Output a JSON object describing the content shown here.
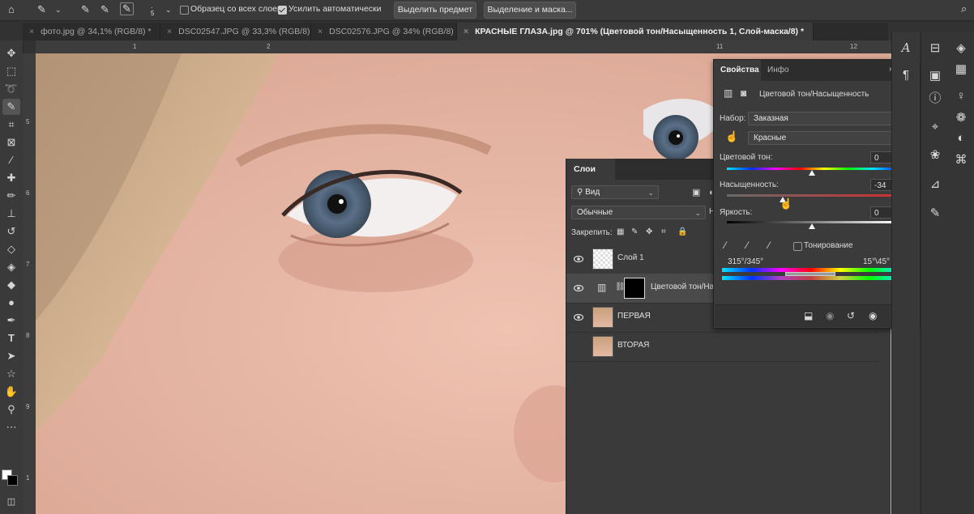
{
  "options_bar": {
    "brush_size": "5",
    "sample_all_layers_label": "Образец со всех слоев",
    "auto_enhance_label": "Усилить автоматически",
    "select_subject_label": "Выделить предмет",
    "select_mask_label": "Выделение и маска..."
  },
  "tabs": [
    {
      "label": "фото.jpg @ 34,1% (RGB/8) *",
      "active": false
    },
    {
      "label": "DSC02547.JPG @ 33,3% (RGB/8)",
      "active": false
    },
    {
      "label": "DSC02576.JPG @ 34% (RGB/8)",
      "active": false
    },
    {
      "label": "КРАСНЫЕ ГЛАЗА.jpg @ 701% (Цветовой тон/Насыщенность 1, Слой-маска/8) *",
      "active": true
    }
  ],
  "ruler_top": {
    "t1": "1",
    "t2": "2",
    "t3": "11",
    "t4": "12"
  },
  "ruler_left": {
    "t1": "5",
    "t2": "6",
    "t3": "7",
    "t4": "8",
    "t5": "9",
    "t6": "1"
  },
  "layers_panel": {
    "tab_label": "Слои",
    "filter_kind": "Вид",
    "blend_mode": "Обычные",
    "opacity_prefix": "Н",
    "lock_label": "Закрепить:",
    "layers": [
      {
        "name": "Слой 1",
        "visible": true
      },
      {
        "name": "Цветовой тон/Нас",
        "visible": true
      },
      {
        "name": "ПЕРВАЯ",
        "visible": true
      },
      {
        "name": "ВТОРАЯ",
        "visible": false
      }
    ]
  },
  "properties_panel": {
    "tab_properties": "Свойства",
    "tab_info": "Инфо",
    "adjustment_title": "Цветовой тон/Насыщенность",
    "preset_label": "Набор:",
    "preset_value": "Заказная",
    "channel_value": "Красные",
    "hue_label": "Цветовой тон:",
    "hue_value": "0",
    "hue_knob": 0.5,
    "saturation_label": "Насыщенность:",
    "saturation_value": "-34",
    "saturation_knob": 0.33,
    "lightness_label": "Яркость:",
    "lightness_value": "0",
    "lightness_knob": 0.5,
    "colorize_label": "Тонирование",
    "range_left": "315°/345°",
    "range_right": "15°\\45°"
  },
  "colors": {
    "ui_bg": "#323232",
    "panel_bg": "#3a3a3a",
    "skin": "#e9b9a8"
  }
}
